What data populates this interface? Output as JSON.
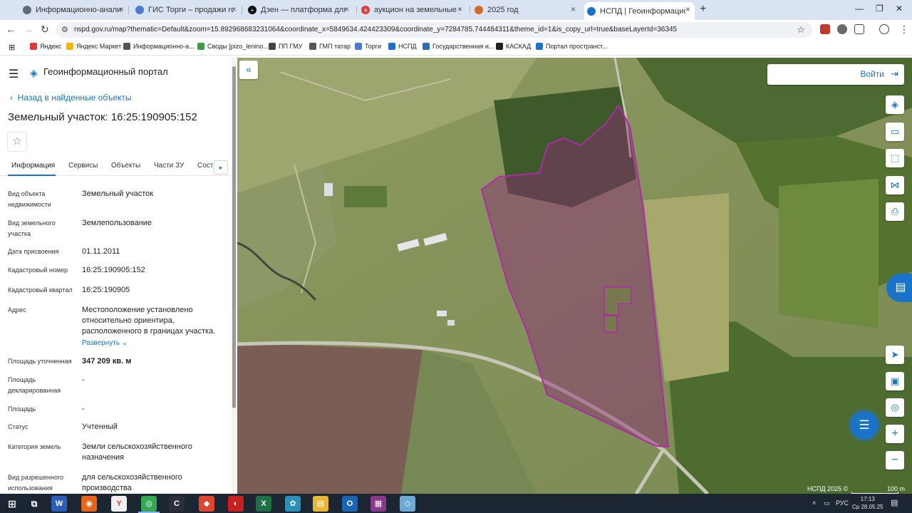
{
  "browser": {
    "tabs": [
      {
        "label": "Информационно-аналитиче",
        "favicon_color": "#5f6b7a"
      },
      {
        "label": "ГИС Торги – продажи государ",
        "favicon_color": "#4a7bd0"
      },
      {
        "label": "Дзен — платформа для прос",
        "favicon_color": "#111111"
      },
      {
        "label": "аукцион на земельные участ",
        "favicon_color": "#e03a3a"
      },
      {
        "label": "2025 год",
        "favicon_color": "#d26b2a"
      },
      {
        "label": "НСПД | Геоинформационный",
        "favicon_color": "#1a73c8"
      }
    ],
    "new_tab": "+",
    "url": "nspd.gov.ru/map?thematic=Default&zoom=15.892968683231064&coordinate_x=5849634.424423309&coordinate_y=7284785.744484311&theme_id=1&is_copy_url=true&baseLayerId=36345",
    "bookmarks": [
      {
        "label": "Яндекс",
        "color": "#e03a3a"
      },
      {
        "label": "Яндекс Маркет",
        "color": "#f2b705"
      },
      {
        "label": "Информационно-а...",
        "color": "#555555"
      },
      {
        "label": "Своды [pizo_lenino...",
        "color": "#3b9b4a"
      },
      {
        "label": "ПП ГМУ",
        "color": "#444444"
      },
      {
        "label": "ГМП татар",
        "color": "#555555"
      },
      {
        "label": "Торги",
        "color": "#4a7bd0"
      },
      {
        "label": "НСПД",
        "color": "#1a73c8"
      },
      {
        "label": "Государственная и...",
        "color": "#2f6db5"
      },
      {
        "label": "КАСКАД",
        "color": "#222222"
      },
      {
        "label": "Портал пространст...",
        "color": "#1a73c8"
      }
    ]
  },
  "portal": {
    "title": "Геоинформационный портал",
    "back_link": "Назад в найденные объекты",
    "object_title": "Земельный участок: 16:25:190905:152",
    "tabs": [
      "Информация",
      "Сервисы",
      "Объекты",
      "Части ЗУ",
      "Сост"
    ],
    "fields": [
      {
        "label": "Вид объекта недвижимости",
        "value": "Земельный участок"
      },
      {
        "label": "Вид земельного участка",
        "value": "Землепользование"
      },
      {
        "label": "Дата присвоения",
        "value": "01.11.2011"
      },
      {
        "label": "Кадастровый номер",
        "value": "16:25:190905:152"
      },
      {
        "label": "Кадастровый квартал",
        "value": "16:25:190905"
      },
      {
        "label": "Адрес",
        "value": "Местоположение установлено относительно ориентира, расположенного в границах участка.",
        "link": "Развернуть"
      },
      {
        "label": "Площадь уточненная",
        "value": "347 209 кв. м"
      },
      {
        "label": "Площадь декларированная",
        "value": "-"
      },
      {
        "label": "Площадь",
        "value": "-"
      },
      {
        "label": "Статус",
        "value": "Учтенный"
      },
      {
        "label": "Категория земель",
        "value": "Земли сельскохозяйственного назначения"
      },
      {
        "label": "Вид разрешенного использования",
        "value": "для сельскохозяйственного производства"
      }
    ]
  },
  "map": {
    "login": "Войти",
    "attribution": "НСПД 2025 ©",
    "scale": "100 m",
    "parcel_color": "#b02aa8"
  },
  "taskbar": {
    "apps": [
      {
        "label": "W",
        "color": "#2b5eb5"
      },
      {
        "label": "◉",
        "color": "#e8641b"
      },
      {
        "label": "Y",
        "color": "#f0f0f0"
      },
      {
        "label": "◎",
        "color": "#34a853"
      },
      {
        "label": "C",
        "color": "#2a2f3a"
      },
      {
        "label": "◆",
        "color": "#e0452f"
      },
      {
        "label": "◐",
        "color": "#c8201f"
      },
      {
        "label": "X",
        "color": "#1d7044"
      },
      {
        "label": "✿",
        "color": "#2b8fb8"
      },
      {
        "label": "▤",
        "color": "#e9b637"
      },
      {
        "label": "O",
        "color": "#1a64b4"
      },
      {
        "label": "▦",
        "color": "#8a3a8a"
      },
      {
        "label": "◇",
        "color": "#6ba9d6"
      }
    ],
    "language": "РУС",
    "time": "17:13",
    "date": "Ср 28.05.25"
  }
}
